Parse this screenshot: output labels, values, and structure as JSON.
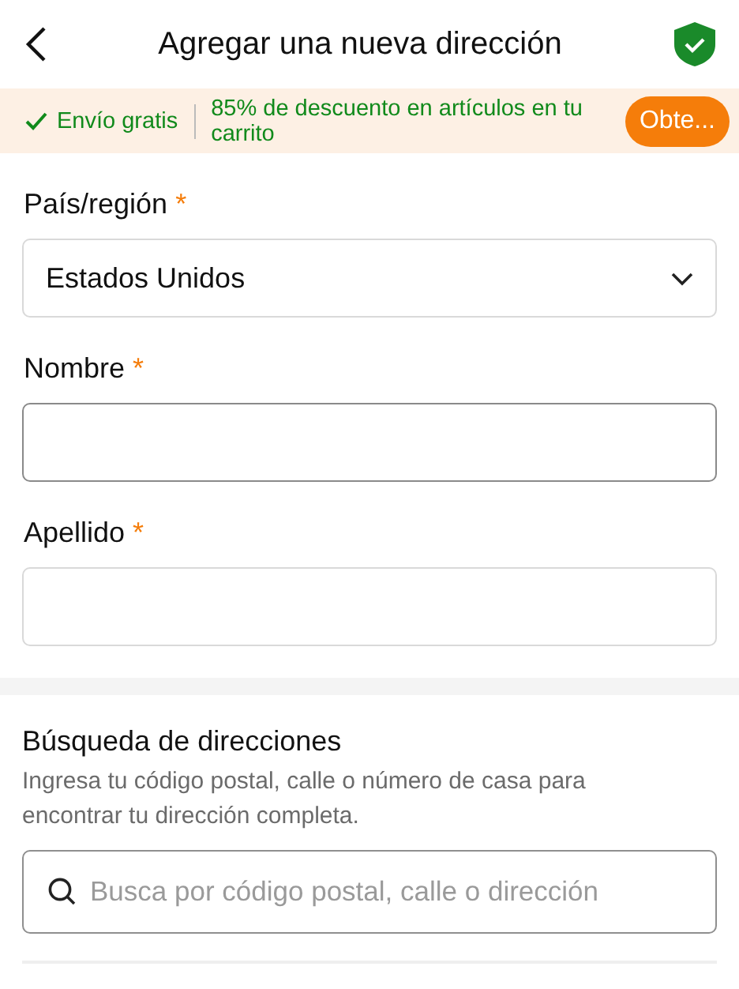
{
  "header": {
    "title": "Agregar una nueva dirección"
  },
  "banner": {
    "free_shipping": "Envío gratis",
    "discount": "85% de descuento en artículos en tu carrito",
    "button": "Obte..."
  },
  "fields": [
    {
      "kind": "select",
      "label": "País/región",
      "required_mark": "*",
      "value": "Estados Unidos",
      "focused": false
    },
    {
      "kind": "text",
      "label": "Nombre",
      "required_mark": "*",
      "focused": true
    },
    {
      "kind": "text",
      "label": "Apellido",
      "required_mark": "*",
      "focused": false
    }
  ],
  "address_search": {
    "title": "Búsqueda de direcciones",
    "description": "Ingresa tu código postal, calle o número de casa para encontrar tu dirección completa.",
    "placeholder": "Busca por código postal, calle o dirección"
  }
}
